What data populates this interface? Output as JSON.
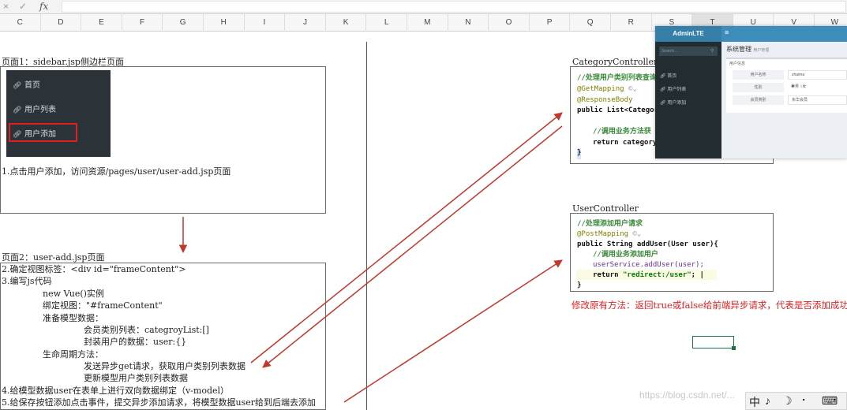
{
  "formula_bar": {
    "cancel_glyph": "×",
    "confirm_glyph": "✓",
    "fx_label": "fx",
    "value": ""
  },
  "columns": [
    "C",
    "D",
    "E",
    "F",
    "G",
    "H",
    "I",
    "J",
    "K",
    "L",
    "M",
    "N",
    "O",
    "P",
    "Q",
    "R",
    "S",
    "T",
    "U",
    "V",
    "W"
  ],
  "section1": {
    "title": "页面1：sidebar.jsp侧边栏页面",
    "sidebar_items": [
      "首页",
      "用户列表",
      "用户添加"
    ],
    "sidebar_icon": "link-icon",
    "step1": "1.点击用户添加，访问资源/pages/user/user-add.jsp页面"
  },
  "section2": {
    "title": "页面2：user-add.jsp页面",
    "lines": [
      "2.确定视图标签：<div id=\"frameContent\">",
      "3.编写js代码",
      "new Vue()实例",
      "绑定视图：\"#frameContent\"",
      "准备模型数据：",
      "会员类别列表：categroyList:[]",
      "封装用户的数据：user:{}",
      "生命周期方法：",
      "发送异步get请求，获取用户类别列表数据",
      "更新模型用户类别列表数据",
      "4.给模型数据user在表单上进行双向数据绑定（v-model）",
      "5.给保存按钮添加点击事件，提交异步添加请求，将模型数据user给到后端去添加"
    ]
  },
  "category_controller": {
    "title": "CategoryController",
    "comment": "//处理用户类别列表查询",
    "get_mapping": "@GetMapping",
    "response_body": "@ResponseBody",
    "signature": "public List<Categor",
    "body_comment": "//调用业务方法获",
    "return_stmt": "return category",
    "close": "}"
  },
  "user_controller": {
    "title": "UserController",
    "comment": "//处理添加用户请求",
    "post_mapping": "@PostMapping",
    "signature": "public String addUser(User user){",
    "body_comment": "//调用业务添加用户",
    "call": "userService.addUser(user);",
    "return_kw": "return ",
    "return_str": "\"redirect:/user\"",
    "return_end": ";",
    "close": "}",
    "note": "修改原有方法：返回true或false给前端异步请求，代表是否添加成功"
  },
  "adminlte": {
    "logo": "AdminLTE",
    "hamburger": "≡",
    "search_placeholder": "Search...",
    "nav": [
      "首页",
      "用户列表",
      "用户添加"
    ],
    "page_title": "系统管理",
    "page_subtitle": "用户管理",
    "panel_header": "用户信息",
    "fields": [
      {
        "label": "用户名称",
        "value": "zhaima"
      },
      {
        "label": "性别",
        "value": "男 ○女"
      },
      {
        "label": "会员类别",
        "value": "东华会员"
      }
    ]
  },
  "watermark": "https://blog.csdn.net/...",
  "ime": [
    "中",
    "♪",
    "☽",
    "⠂",
    "⌨"
  ],
  "colors": {
    "arrow": "#c0392b",
    "highlight": "#e02020",
    "admin_blue": "#3c8dbc",
    "sidebar_dark": "#2c3338",
    "note_red": "#e02020"
  }
}
